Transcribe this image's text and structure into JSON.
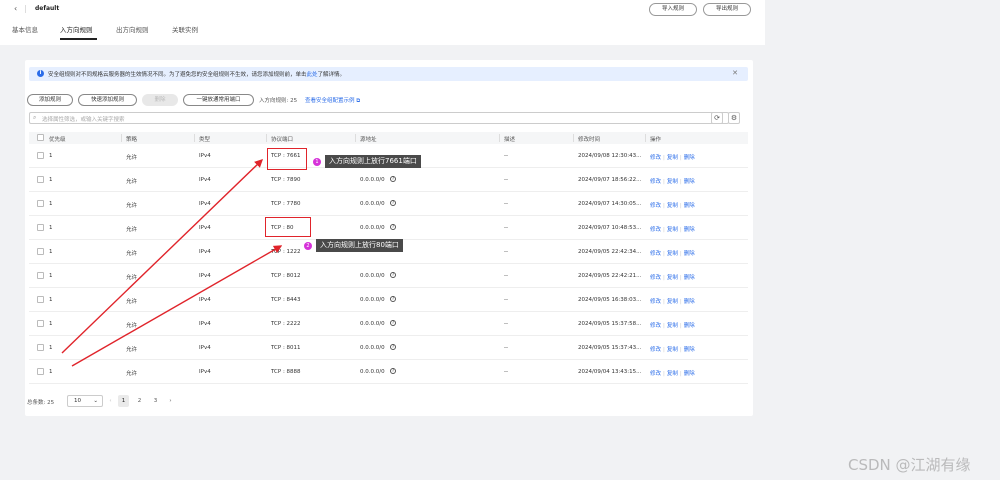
{
  "header": {
    "back_icon": "‹",
    "title": "default",
    "import_label": "导入规则",
    "export_label": "导出规则"
  },
  "tabs": [
    {
      "label": "基本信息"
    },
    {
      "label": "入方向规则"
    },
    {
      "label": "出方向规则"
    },
    {
      "label": "关联实例"
    }
  ],
  "notice": {
    "text": "安全组规则对不同规格云服务器的生效情况不同。为了避免您的安全组规则不生效，请您添加规则前，单击",
    "link": "此处",
    "suffix": "了解详情。"
  },
  "toolbar": {
    "add_rule": "添加规则",
    "quick_add": "快速添加规则",
    "delete": "删除",
    "open_common_ports": "一键放通常用端口",
    "inbound_count": "入方向规则: 25",
    "example_link": "查看安全组配置示例"
  },
  "search": {
    "placeholder": "选择属性筛选，或输入关键字搜索"
  },
  "table": {
    "headers": [
      "优先级",
      "策略",
      "类型",
      "协议端口",
      "源地址",
      "描述",
      "修改时间",
      "操作"
    ],
    "actions": [
      "修改",
      "复制",
      "删除"
    ],
    "rows": [
      {
        "priority": "1",
        "policy": "允许",
        "type": "IPv4",
        "port": "TCP : 7661",
        "source": "",
        "desc": "--",
        "time": "2024/09/08 12:30:43..."
      },
      {
        "priority": "1",
        "policy": "允许",
        "type": "IPv4",
        "port": "TCP : 7890",
        "source": "0.0.0.0/0",
        "desc": "--",
        "time": "2024/09/07 18:56:22..."
      },
      {
        "priority": "1",
        "policy": "允许",
        "type": "IPv4",
        "port": "TCP : 7780",
        "source": "0.0.0.0/0",
        "desc": "--",
        "time": "2024/09/07 14:30:05..."
      },
      {
        "priority": "1",
        "policy": "允许",
        "type": "IPv4",
        "port": "TCP : 80",
        "source": "0.0.0.0/0",
        "desc": "--",
        "time": "2024/09/07 10:48:53..."
      },
      {
        "priority": "1",
        "policy": "允许",
        "type": "IPv4",
        "port": "TCP : 1222",
        "source": "",
        "desc": "--",
        "time": "2024/09/05 22:42:34..."
      },
      {
        "priority": "1",
        "policy": "允许",
        "type": "IPv4",
        "port": "TCP : 8012",
        "source": "0.0.0.0/0",
        "desc": "--",
        "time": "2024/09/05 22:42:21..."
      },
      {
        "priority": "1",
        "policy": "允许",
        "type": "IPv4",
        "port": "TCP : 8443",
        "source": "0.0.0.0/0",
        "desc": "--",
        "time": "2024/09/05 16:38:03..."
      },
      {
        "priority": "1",
        "policy": "允许",
        "type": "IPv4",
        "port": "TCP : 2222",
        "source": "0.0.0.0/0",
        "desc": "--",
        "time": "2024/09/05 15:37:58..."
      },
      {
        "priority": "1",
        "policy": "允许",
        "type": "IPv4",
        "port": "TCP : 8011",
        "source": "0.0.0.0/0",
        "desc": "--",
        "time": "2024/09/05 15:37:43..."
      },
      {
        "priority": "1",
        "policy": "允许",
        "type": "IPv4",
        "port": "TCP : 8888",
        "source": "0.0.0.0/0",
        "desc": "--",
        "time": "2024/09/04 13:43:15..."
      }
    ]
  },
  "pagination": {
    "total": "总条数: 25",
    "page_size": "10",
    "pages": [
      "1",
      "2",
      "3"
    ],
    "current": "1"
  },
  "annotations": {
    "callout1_num": "1",
    "callout1_text": "入方向规则上放行7661端口",
    "callout2_num": "2",
    "callout2_text": "入方向规则上放行80端口",
    "color": "#e0242b"
  },
  "watermark": "CSDN @江湖有缘"
}
